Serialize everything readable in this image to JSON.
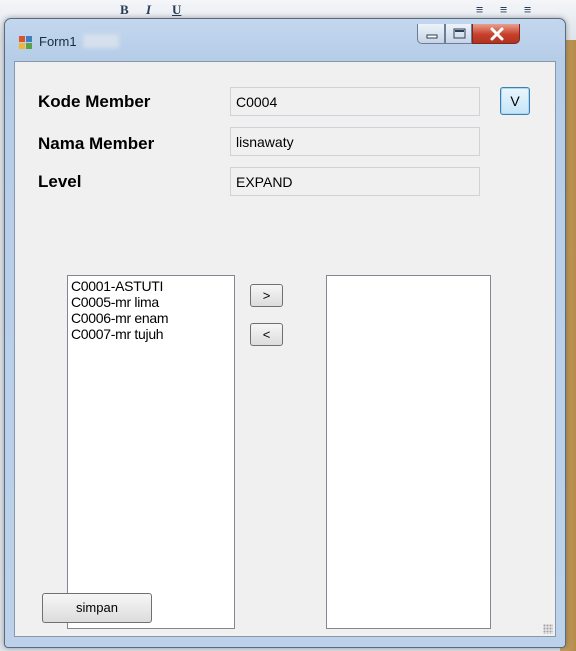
{
  "window": {
    "title": "Form1",
    "controls": {
      "minimize": "minimize",
      "maximize": "maximize",
      "close": "close"
    }
  },
  "form": {
    "kode_member": {
      "label": "Kode Member",
      "value": "C0004"
    },
    "nama_member": {
      "label": "Nama Member",
      "value": "lisnawaty"
    },
    "level": {
      "label": "Level",
      "value": "EXPAND"
    },
    "view_button": "V"
  },
  "left_list": {
    "items": [
      "C0001-ASTUTI",
      "C0005-mr lima",
      "C0006-mr enam",
      "C0007-mr tujuh"
    ]
  },
  "right_list": {
    "items": []
  },
  "move_right_button": ">",
  "move_left_button": "<",
  "save_button": "simpan",
  "colors": {
    "title_bar": "#b6cde8",
    "close_button": "#c8402a",
    "client_bg": "#f0f0f0",
    "focus_border": "#3c7fb1"
  }
}
